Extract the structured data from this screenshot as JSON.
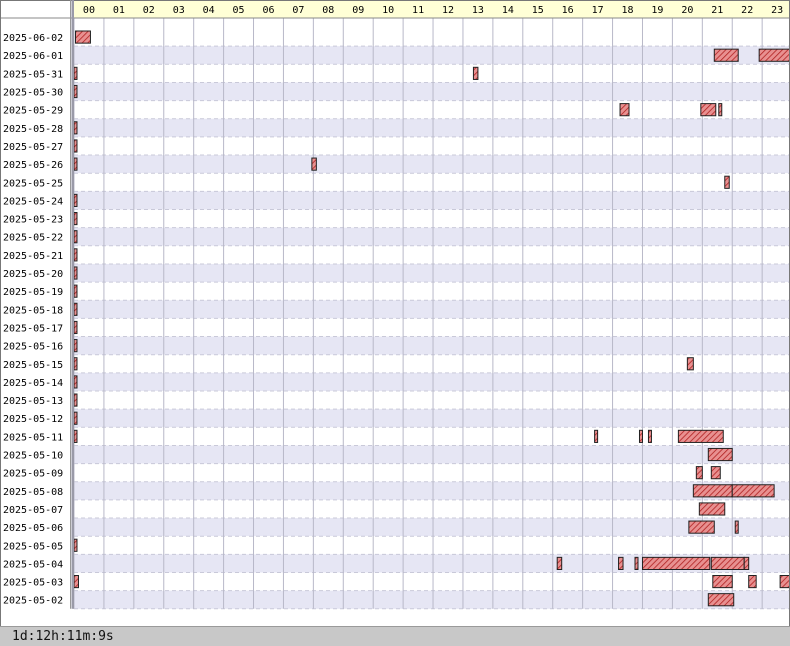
{
  "chart_data": {
    "type": "timeline",
    "x_unit": "hour of day",
    "hours": [
      "00",
      "01",
      "02",
      "03",
      "04",
      "05",
      "06",
      "07",
      "08",
      "09",
      "10",
      "11",
      "12",
      "13",
      "14",
      "15",
      "16",
      "17",
      "18",
      "19",
      "20",
      "21",
      "22",
      "23"
    ],
    "dates": [
      "2025-06-02",
      "2025-06-01",
      "2025-05-31",
      "2025-05-30",
      "2025-05-29",
      "2025-05-28",
      "2025-05-27",
      "2025-05-26",
      "2025-05-25",
      "2025-05-24",
      "2025-05-23",
      "2025-05-22",
      "2025-05-21",
      "2025-05-20",
      "2025-05-19",
      "2025-05-18",
      "2025-05-17",
      "2025-05-16",
      "2025-05-15",
      "2025-05-14",
      "2025-05-13",
      "2025-05-12",
      "2025-05-11",
      "2025-05-10",
      "2025-05-09",
      "2025-05-08",
      "2025-05-07",
      "2025-05-06",
      "2025-05-05",
      "2025-05-04",
      "2025-05-03",
      "2025-05-02"
    ],
    "intervals": [
      {
        "date": "2025-06-02",
        "spans": [
          [
            0.05,
            0.55
          ]
        ]
      },
      {
        "date": "2025-06-01",
        "spans": [
          [
            21.4,
            22.2
          ],
          [
            22.9,
            24.0
          ]
        ]
      },
      {
        "date": "2025-05-31",
        "spans": [
          [
            0.0,
            0.1
          ],
          [
            13.35,
            13.5
          ]
        ]
      },
      {
        "date": "2025-05-30",
        "spans": [
          [
            0.0,
            0.1
          ]
        ]
      },
      {
        "date": "2025-05-29",
        "spans": [
          [
            18.25,
            18.55
          ],
          [
            20.95,
            21.45
          ],
          [
            21.55,
            21.65
          ]
        ]
      },
      {
        "date": "2025-05-28",
        "spans": [
          [
            0.0,
            0.1
          ]
        ]
      },
      {
        "date": "2025-05-27",
        "spans": [
          [
            0.0,
            0.1
          ]
        ]
      },
      {
        "date": "2025-05-26",
        "spans": [
          [
            0.0,
            0.1
          ],
          [
            7.95,
            8.1
          ]
        ]
      },
      {
        "date": "2025-05-25",
        "spans": [
          [
            21.75,
            21.9
          ]
        ]
      },
      {
        "date": "2025-05-24",
        "spans": [
          [
            0.0,
            0.1
          ]
        ]
      },
      {
        "date": "2025-05-23",
        "spans": [
          [
            0.0,
            0.1
          ]
        ]
      },
      {
        "date": "2025-05-22",
        "spans": [
          [
            0.0,
            0.1
          ]
        ]
      },
      {
        "date": "2025-05-21",
        "spans": [
          [
            0.0,
            0.1
          ]
        ]
      },
      {
        "date": "2025-05-20",
        "spans": [
          [
            0.0,
            0.1
          ]
        ]
      },
      {
        "date": "2025-05-19",
        "spans": [
          [
            0.0,
            0.1
          ]
        ]
      },
      {
        "date": "2025-05-18",
        "spans": [
          [
            0.0,
            0.1
          ]
        ]
      },
      {
        "date": "2025-05-17",
        "spans": [
          [
            0.0,
            0.1
          ]
        ]
      },
      {
        "date": "2025-05-16",
        "spans": [
          [
            0.0,
            0.1
          ]
        ]
      },
      {
        "date": "2025-05-15",
        "spans": [
          [
            0.0,
            0.1
          ],
          [
            20.5,
            20.7
          ]
        ]
      },
      {
        "date": "2025-05-14",
        "spans": [
          [
            0.0,
            0.1
          ]
        ]
      },
      {
        "date": "2025-05-13",
        "spans": [
          [
            0.0,
            0.1
          ]
        ]
      },
      {
        "date": "2025-05-12",
        "spans": [
          [
            0.0,
            0.1
          ]
        ]
      },
      {
        "date": "2025-05-11",
        "spans": [
          [
            0.0,
            0.1
          ],
          [
            17.4,
            17.5
          ],
          [
            18.9,
            19.0
          ],
          [
            19.2,
            19.3
          ],
          [
            20.2,
            21.7
          ]
        ]
      },
      {
        "date": "2025-05-10",
        "spans": [
          [
            21.2,
            22.0
          ]
        ]
      },
      {
        "date": "2025-05-09",
        "spans": [
          [
            20.8,
            21.0
          ],
          [
            21.3,
            21.6
          ]
        ]
      },
      {
        "date": "2025-05-08",
        "spans": [
          [
            20.7,
            22.0
          ],
          [
            22.0,
            23.4
          ]
        ]
      },
      {
        "date": "2025-05-07",
        "spans": [
          [
            20.9,
            21.75
          ]
        ]
      },
      {
        "date": "2025-05-06",
        "spans": [
          [
            20.55,
            21.4
          ],
          [
            22.1,
            22.2
          ]
        ]
      },
      {
        "date": "2025-05-05",
        "spans": [
          [
            0.0,
            0.1
          ]
        ]
      },
      {
        "date": "2025-05-04",
        "spans": [
          [
            16.15,
            16.3
          ],
          [
            18.2,
            18.35
          ],
          [
            18.75,
            18.85
          ],
          [
            19.0,
            21.25
          ],
          [
            21.3,
            22.4
          ],
          [
            22.4,
            22.55
          ]
        ]
      },
      {
        "date": "2025-05-03",
        "spans": [
          [
            0.0,
            0.15
          ],
          [
            21.35,
            22.0
          ],
          [
            22.55,
            22.8
          ],
          [
            23.6,
            24.0
          ]
        ]
      },
      {
        "date": "2025-05-02",
        "spans": [
          [
            21.2,
            22.05
          ]
        ]
      }
    ]
  },
  "status": {
    "elapsed": "1d:12h:11m:9s"
  }
}
